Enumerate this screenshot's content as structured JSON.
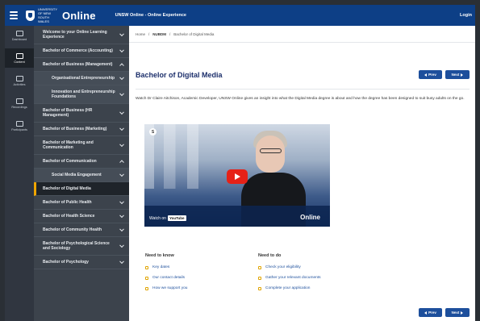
{
  "topbar": {
    "logo_small": "UNIVERSITY OF NEW SOUTH WALES",
    "logo_online": "Online",
    "title": "UNSW Online - Online Experience",
    "login": "Login"
  },
  "rail": [
    {
      "label": "Dashboard",
      "icon": "dashboard-icon",
      "active": false
    },
    {
      "label": "Content",
      "icon": "content-icon",
      "active": true
    },
    {
      "label": "Activities",
      "icon": "activities-icon",
      "active": false
    },
    {
      "label": "Recordings",
      "icon": "recordings-icon",
      "active": false
    },
    {
      "label": "Participants",
      "icon": "participants-icon",
      "active": false
    }
  ],
  "sidebar": {
    "items": [
      {
        "label": "Welcome to your Online Learning Experience"
      },
      {
        "label": "Bachelor of Commerce (Accounting)"
      },
      {
        "label": "Bachelor of Business (Management)"
      },
      {
        "label": "Organisational Entrepreneurship"
      },
      {
        "label": "Innovation and Entrepreneurship Foundations"
      },
      {
        "label": "Bachelor of Business (HR Management)"
      },
      {
        "label": "Bachelor of Business (Marketing)"
      },
      {
        "label": "Bachelor of Marketing and Communication"
      },
      {
        "label": "Bachelor of Communication"
      },
      {
        "label": "Social Media Engagement"
      },
      {
        "label": "Bachelor of Digital Media"
      },
      {
        "label": "Bachelor of Public Health"
      },
      {
        "label": "Bachelor of Health Science"
      },
      {
        "label": "Bachelor of Community Health"
      },
      {
        "label": "Bachelor of Psychological Science and Sociology"
      },
      {
        "label": "Bachelor of Psychology"
      }
    ]
  },
  "breadcrumb": {
    "home": "Home",
    "sep": "/",
    "section": "NUBDM",
    "current": "Bachelor of Digital Media"
  },
  "main": {
    "title": "Bachelor of Digital Media",
    "prev_label": "Prev",
    "next_label": "Next",
    "intro": "Watch Dr Claire Aitchison, Academic Developer, UNSW Online gives an insight into what the Digital Media degree is about and how the degree has been designed to suit busy adults on the go."
  },
  "video": {
    "channel_initial": "S",
    "watch_on": "Watch on",
    "youtube": "YouTube",
    "brand": "Online"
  },
  "need_to_know": {
    "title": "Need to know",
    "items": [
      "Key dates",
      "Our contact details",
      "How we support you"
    ]
  },
  "need_to_do": {
    "title": "Need to do",
    "items": [
      "Check your eligibility",
      "Gather your relevant documents",
      "Complete your application"
    ]
  },
  "colors": {
    "topbar": "#0d3f86",
    "accent": "#1d4f9c",
    "title": "#1c2f6b",
    "active_marker": "#f0a500"
  }
}
